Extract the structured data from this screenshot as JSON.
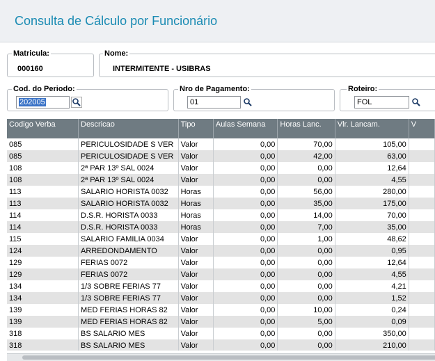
{
  "page": {
    "title": "Consulta de Cálculo por Funcionário"
  },
  "fields": {
    "matricula": {
      "label": "Matricula:",
      "value": "000160"
    },
    "nome": {
      "label": "Nome:",
      "value": "INTERMITENTE - USIBRAS"
    },
    "cod_periodo": {
      "label": "Cod. do Periodo:",
      "value": "202005"
    },
    "nro_pagamento": {
      "label": "Nro de Pagamento:",
      "value": "01"
    },
    "roteiro": {
      "label": "Roteiro:",
      "value": "FOL"
    }
  },
  "table": {
    "headers": [
      "Codigo Verba",
      "Descricao",
      "Tipo",
      "Aulas Semana",
      "Horas Lanc.",
      "Vlr. Lancam.",
      "V"
    ],
    "rows": [
      [
        "085",
        "PERICULOSIDADE S VER",
        "Valor",
        "0,00",
        "70,00",
        "105,00"
      ],
      [
        "085",
        "PERICULOSIDADE S VER",
        "Valor",
        "0,00",
        "42,00",
        "63,00"
      ],
      [
        "108",
        "2ª PAR 13º SAL 0024",
        "Valor",
        "0,00",
        "0,00",
        "12,64"
      ],
      [
        "108",
        "2ª PAR 13º SAL 0024",
        "Valor",
        "0,00",
        "0,00",
        "4,55"
      ],
      [
        "113",
        "SALARIO HORISTA 0032",
        "Horas",
        "0,00",
        "56,00",
        "280,00"
      ],
      [
        "113",
        "SALARIO HORISTA 0032",
        "Horas",
        "0,00",
        "35,00",
        "175,00"
      ],
      [
        "114",
        "D.S.R. HORISTA  0033",
        "Horas",
        "0,00",
        "14,00",
        "70,00"
      ],
      [
        "114",
        "D.S.R. HORISTA  0033",
        "Horas",
        "0,00",
        "7,00",
        "35,00"
      ],
      [
        "115",
        "SALARIO FAMILIA 0034",
        "Valor",
        "0,00",
        "1,00",
        "48,62"
      ],
      [
        "124",
        "ARREDONDAMENTO",
        "Valor",
        "0,00",
        "0,00",
        "0,95"
      ],
      [
        "129",
        "FERIAS 0072",
        "Valor",
        "0,00",
        "0,00",
        "12,64"
      ],
      [
        "129",
        "FERIAS 0072",
        "Valor",
        "0,00",
        "0,00",
        "4,55"
      ],
      [
        "134",
        "1/3 SOBRE FERIAS 77",
        "Valor",
        "0,00",
        "0,00",
        "4,21"
      ],
      [
        "134",
        "1/3 SOBRE FERIAS 77",
        "Valor",
        "0,00",
        "0,00",
        "1,52"
      ],
      [
        "139",
        "MED FERIAS HORAS 82",
        "Valor",
        "0,00",
        "10,00",
        "0,24"
      ],
      [
        "139",
        "MED FERIAS HORAS 82",
        "Valor",
        "0,00",
        "5,00",
        "0,09"
      ],
      [
        "318",
        "BS SALARIO MES",
        "Valor",
        "0,00",
        "0,00",
        "350,00"
      ],
      [
        "318",
        "BS SALARIO MES",
        "Valor",
        "0,00",
        "0,00",
        "210,00"
      ]
    ]
  },
  "icons": {
    "search": "magnifier-icon"
  },
  "colors": {
    "title": "#1a8bb3",
    "header_bg": "#6f7b82",
    "row_alt": "#e3e3e3",
    "selection": "#3a73c7"
  }
}
